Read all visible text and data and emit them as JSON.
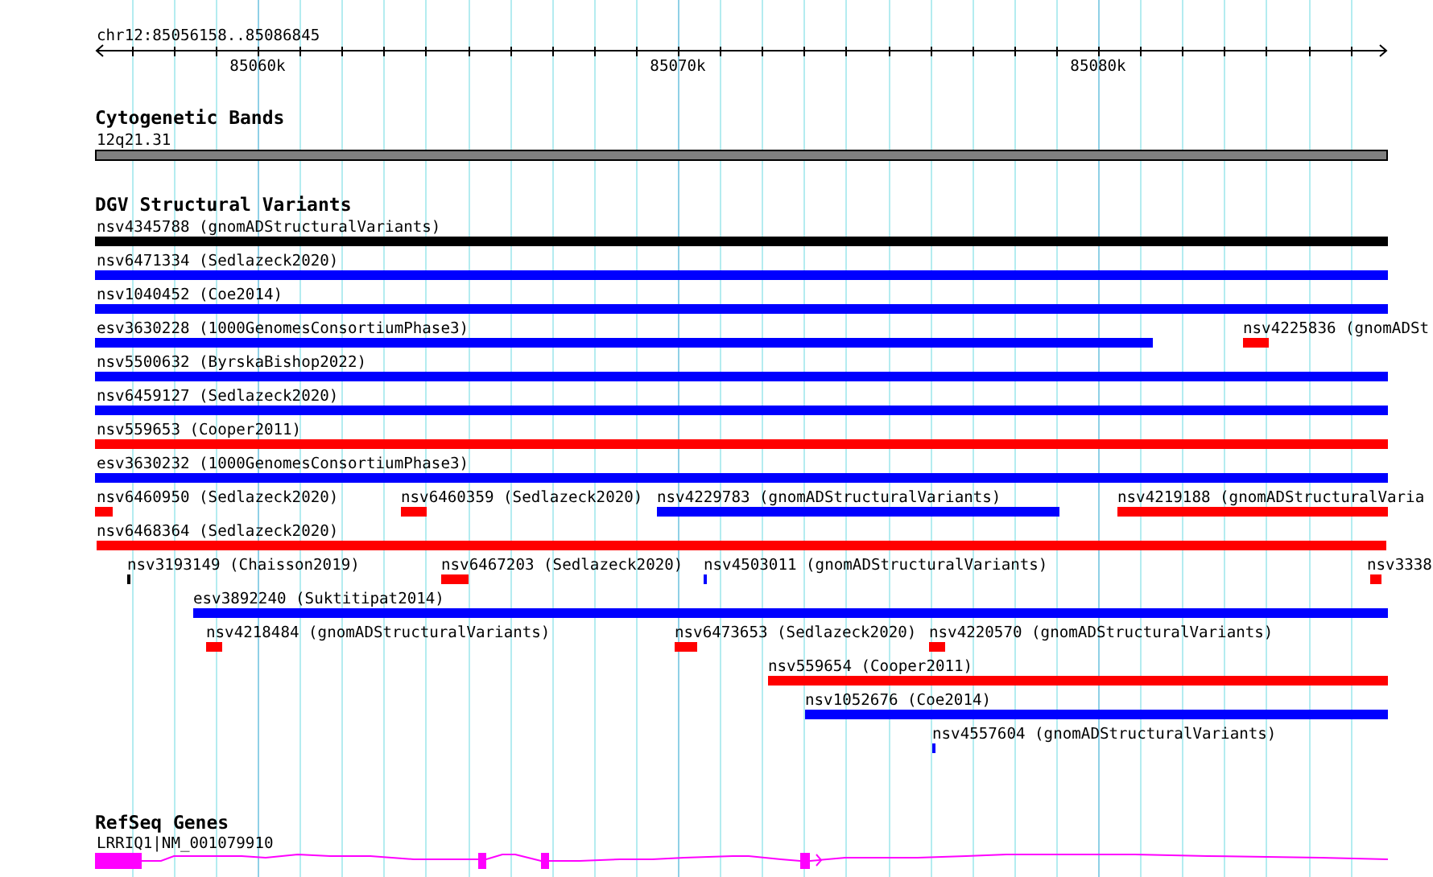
{
  "ruler": {
    "location": "chr12:85056158..85086845",
    "ticks": [
      "85060k",
      "85070k",
      "85080k"
    ]
  },
  "tracks": [
    {
      "kind": "band",
      "title": "Cytogenetic Bands",
      "label": "12q21.31"
    },
    {
      "kind": "variants",
      "title": "DGV Structural Variants",
      "features": [
        {
          "label": "nsv4345788 (gnomADStructuralVariants)",
          "color": "#000000"
        },
        {
          "label": "nsv6471334 (Sedlazeck2020)",
          "color": "#0000ff"
        },
        {
          "label": "nsv1040452 (Coe2014)",
          "color": "#0000ff"
        },
        {
          "label": "esv3630228 (1000GenomesConsortiumPhase3)",
          "color": "#0000ff"
        },
        {
          "label": "nsv4225836 (gnomADSt",
          "color": "#ff0000"
        },
        {
          "label": "nsv5500632 (ByrskaBishop2022)",
          "color": "#0000ff"
        },
        {
          "label": "nsv6459127 (Sedlazeck2020)",
          "color": "#0000ff"
        },
        {
          "label": "nsv559653 (Cooper2011)",
          "color": "#ff0000"
        },
        {
          "label": "esv3630232 (1000GenomesConsortiumPhase3)",
          "color": "#0000ff"
        },
        {
          "label": "nsv6460950 (Sedlazeck2020)",
          "color": "#ff0000"
        },
        {
          "label": "nsv6460359 (Sedlazeck2020)",
          "color": "#ff0000"
        },
        {
          "label": "nsv4229783 (gnomADStructuralVariants)",
          "color": "#0000ff"
        },
        {
          "label": "nsv4219188 (gnomADStructuralVaria",
          "color": "#ff0000"
        },
        {
          "label": "nsv6468364 (Sedlazeck2020)",
          "color": "#ff0000"
        },
        {
          "label": "nsv3193149 (Chaisson2019)",
          "color": "#000000"
        },
        {
          "label": "nsv6467203 (Sedlazeck2020)",
          "color": "#ff0000"
        },
        {
          "label": "nsv4503011 (gnomADStructuralVariants)",
          "color": "#0000ff"
        },
        {
          "label": "nsv3338",
          "color": "#ff0000"
        },
        {
          "label": "esv3892240 (Suktitipat2014)",
          "color": "#0000ff"
        },
        {
          "label": "nsv4218484 (gnomADStructuralVariants)",
          "color": "#ff0000"
        },
        {
          "label": "nsv6473653 (Sedlazeck2020)",
          "color": "#ff0000"
        },
        {
          "label": "nsv4220570 (gnomADStructuralVariants)",
          "color": "#ff0000"
        },
        {
          "label": "nsv559654 (Cooper2011)",
          "color": "#ff0000"
        },
        {
          "label": "nsv1052676 (Coe2014)",
          "color": "#0000ff"
        },
        {
          "label": "nsv4557604 (gnomADStructuralVariants)",
          "color": "#0000ff"
        }
      ]
    },
    {
      "kind": "gene",
      "title": "RefSeq Genes",
      "label": "LRRIQ1|NM_001079910"
    }
  ]
}
